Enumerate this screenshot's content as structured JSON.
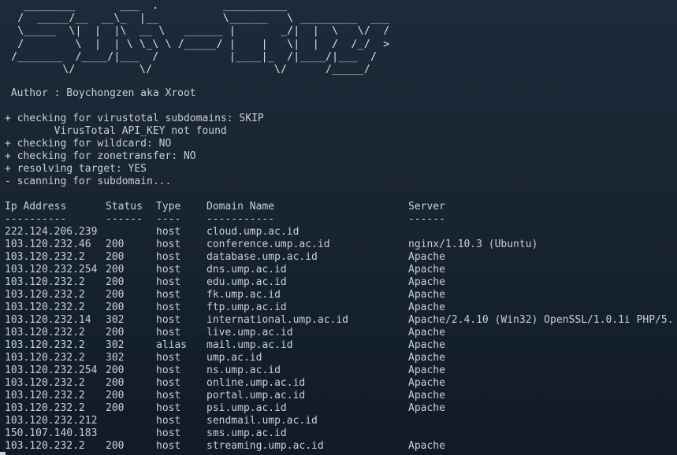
{
  "banner": "   ________       ___  .          __________                \n  /  _____/__  __\\_  |__          \\______   \\ _________  ___   \n  \\_____  \\|  |  |\\  __ \\   ______ |       _/|  |  \\   \\/  /   \n  /        \\  |  | \\ \\_\\ \\ /_____/ |    |   \\|  |  /  /_/  >  \n /_______  /____/|___  /           |____|_  /|____/|___  /   \n         \\/          \\/                   \\/      /_____/    ",
  "author": " Author : Boychongzen aka Xroot",
  "log": [
    "+ checking for virustotal subdomains: SKIP",
    "        VirusTotal API_KEY not found",
    "+ checking for wildcard: NO",
    "+ checking for zonetransfer: NO",
    "+ resolving target: YES",
    "- scanning for subdomain..."
  ],
  "table": {
    "headers": {
      "ip": "Ip Address",
      "status": "Status",
      "type": "Type",
      "domain": "Domain Name",
      "server": "Server"
    },
    "separators": {
      "ip": "----------",
      "status": "------",
      "type": "----",
      "domain": "-----------",
      "server": "------"
    },
    "rows": [
      {
        "ip": "222.124.206.239",
        "status": "",
        "type": "host",
        "domain": "cloud.ump.ac.id",
        "server": ""
      },
      {
        "ip": "103.120.232.46",
        "status": "200",
        "type": "host",
        "domain": "conference.ump.ac.id",
        "server": "nginx/1.10.3 (Ubuntu)"
      },
      {
        "ip": "103.120.232.2",
        "status": "200",
        "type": "host",
        "domain": "database.ump.ac.id",
        "server": "Apache"
      },
      {
        "ip": "103.120.232.254",
        "status": "200",
        "type": "host",
        "domain": "dns.ump.ac.id",
        "server": "Apache"
      },
      {
        "ip": "103.120.232.2",
        "status": "200",
        "type": "host",
        "domain": "edu.ump.ac.id",
        "server": "Apache"
      },
      {
        "ip": "103.120.232.2",
        "status": "200",
        "type": "host",
        "domain": "fk.ump.ac.id",
        "server": "Apache"
      },
      {
        "ip": "103.120.232.2",
        "status": "200",
        "type": "host",
        "domain": "ftp.ump.ac.id",
        "server": "Apache"
      },
      {
        "ip": "103.120.232.14",
        "status": "302",
        "type": "host",
        "domain": "international.ump.ac.id",
        "server": "Apache/2.4.10 (Win32) OpenSSL/1.0.1i PHP/5."
      },
      {
        "ip": "103.120.232.2",
        "status": "200",
        "type": "host",
        "domain": "live.ump.ac.id",
        "server": "Apache"
      },
      {
        "ip": "103.120.232.2",
        "status": "302",
        "type": "alias",
        "domain": "mail.ump.ac.id",
        "server": "Apache"
      },
      {
        "ip": "103.120.232.2",
        "status": "302",
        "type": "host",
        "domain": "ump.ac.id",
        "server": "Apache"
      },
      {
        "ip": "103.120.232.254",
        "status": "200",
        "type": "host",
        "domain": "ns.ump.ac.id",
        "server": "Apache"
      },
      {
        "ip": "103.120.232.2",
        "status": "200",
        "type": "host",
        "domain": "online.ump.ac.id",
        "server": "Apache"
      },
      {
        "ip": "103.120.232.2",
        "status": "200",
        "type": "host",
        "domain": "portal.ump.ac.id",
        "server": "Apache"
      },
      {
        "ip": "103.120.232.2",
        "status": "200",
        "type": "host",
        "domain": "psi.ump.ac.id",
        "server": "Apache"
      },
      {
        "ip": "103.120.232.212",
        "status": "",
        "type": "host",
        "domain": "sendmail.ump.ac.id",
        "server": ""
      },
      {
        "ip": "150.107.140.183",
        "status": "",
        "type": "host",
        "domain": "sms.ump.ac.id",
        "server": ""
      },
      {
        "ip": "103.120.232.2",
        "status": "200",
        "type": "host",
        "domain": "streaming.ump.ac.id",
        "server": "Apache"
      }
    ]
  }
}
